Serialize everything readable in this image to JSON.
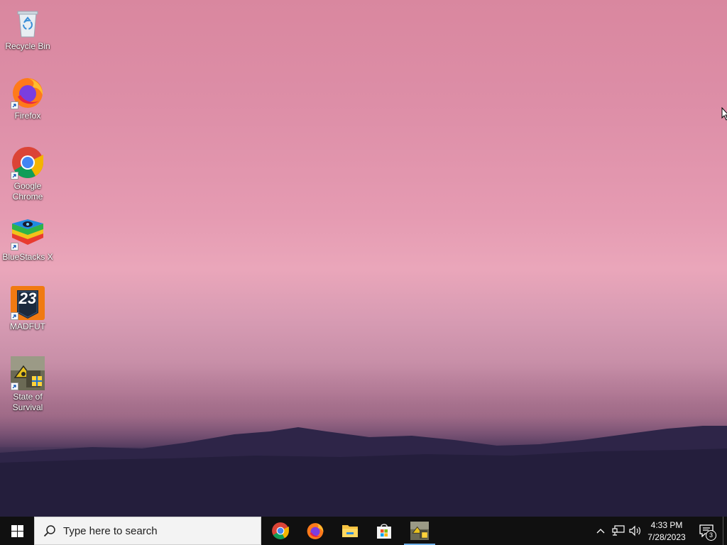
{
  "desktop": {
    "icons": [
      {
        "label": "Recycle Bin",
        "icon": "recycle-bin-icon"
      },
      {
        "label": "Firefox",
        "icon": "firefox-icon"
      },
      {
        "label": "Google Chrome",
        "icon": "chrome-icon"
      },
      {
        "label": "BlueStacks X",
        "icon": "bluestacks-icon"
      },
      {
        "label": "MADFUT",
        "icon": "madfut-icon",
        "badge_text": "23"
      },
      {
        "label": "State of Survival",
        "icon": "state-of-survival-icon"
      }
    ]
  },
  "taskbar": {
    "search_placeholder": "Type here to search",
    "pinned_apps": [
      {
        "name": "Google Chrome",
        "icon": "chrome-icon"
      },
      {
        "name": "Firefox",
        "icon": "firefox-icon"
      },
      {
        "name": "File Explorer",
        "icon": "folder-icon"
      },
      {
        "name": "Microsoft Store",
        "icon": "store-icon"
      },
      {
        "name": "State of Survival",
        "icon": "state-of-survival-icon",
        "active": true
      }
    ],
    "clock": {
      "time": "4:33 PM",
      "date": "7/28/2023"
    },
    "notifications_count": "3"
  },
  "colors": {
    "taskbar_bg": "#101010",
    "active_indicator": "#6fb0e8",
    "sky_top": "#d9879f",
    "mountain": "#2a2444"
  }
}
